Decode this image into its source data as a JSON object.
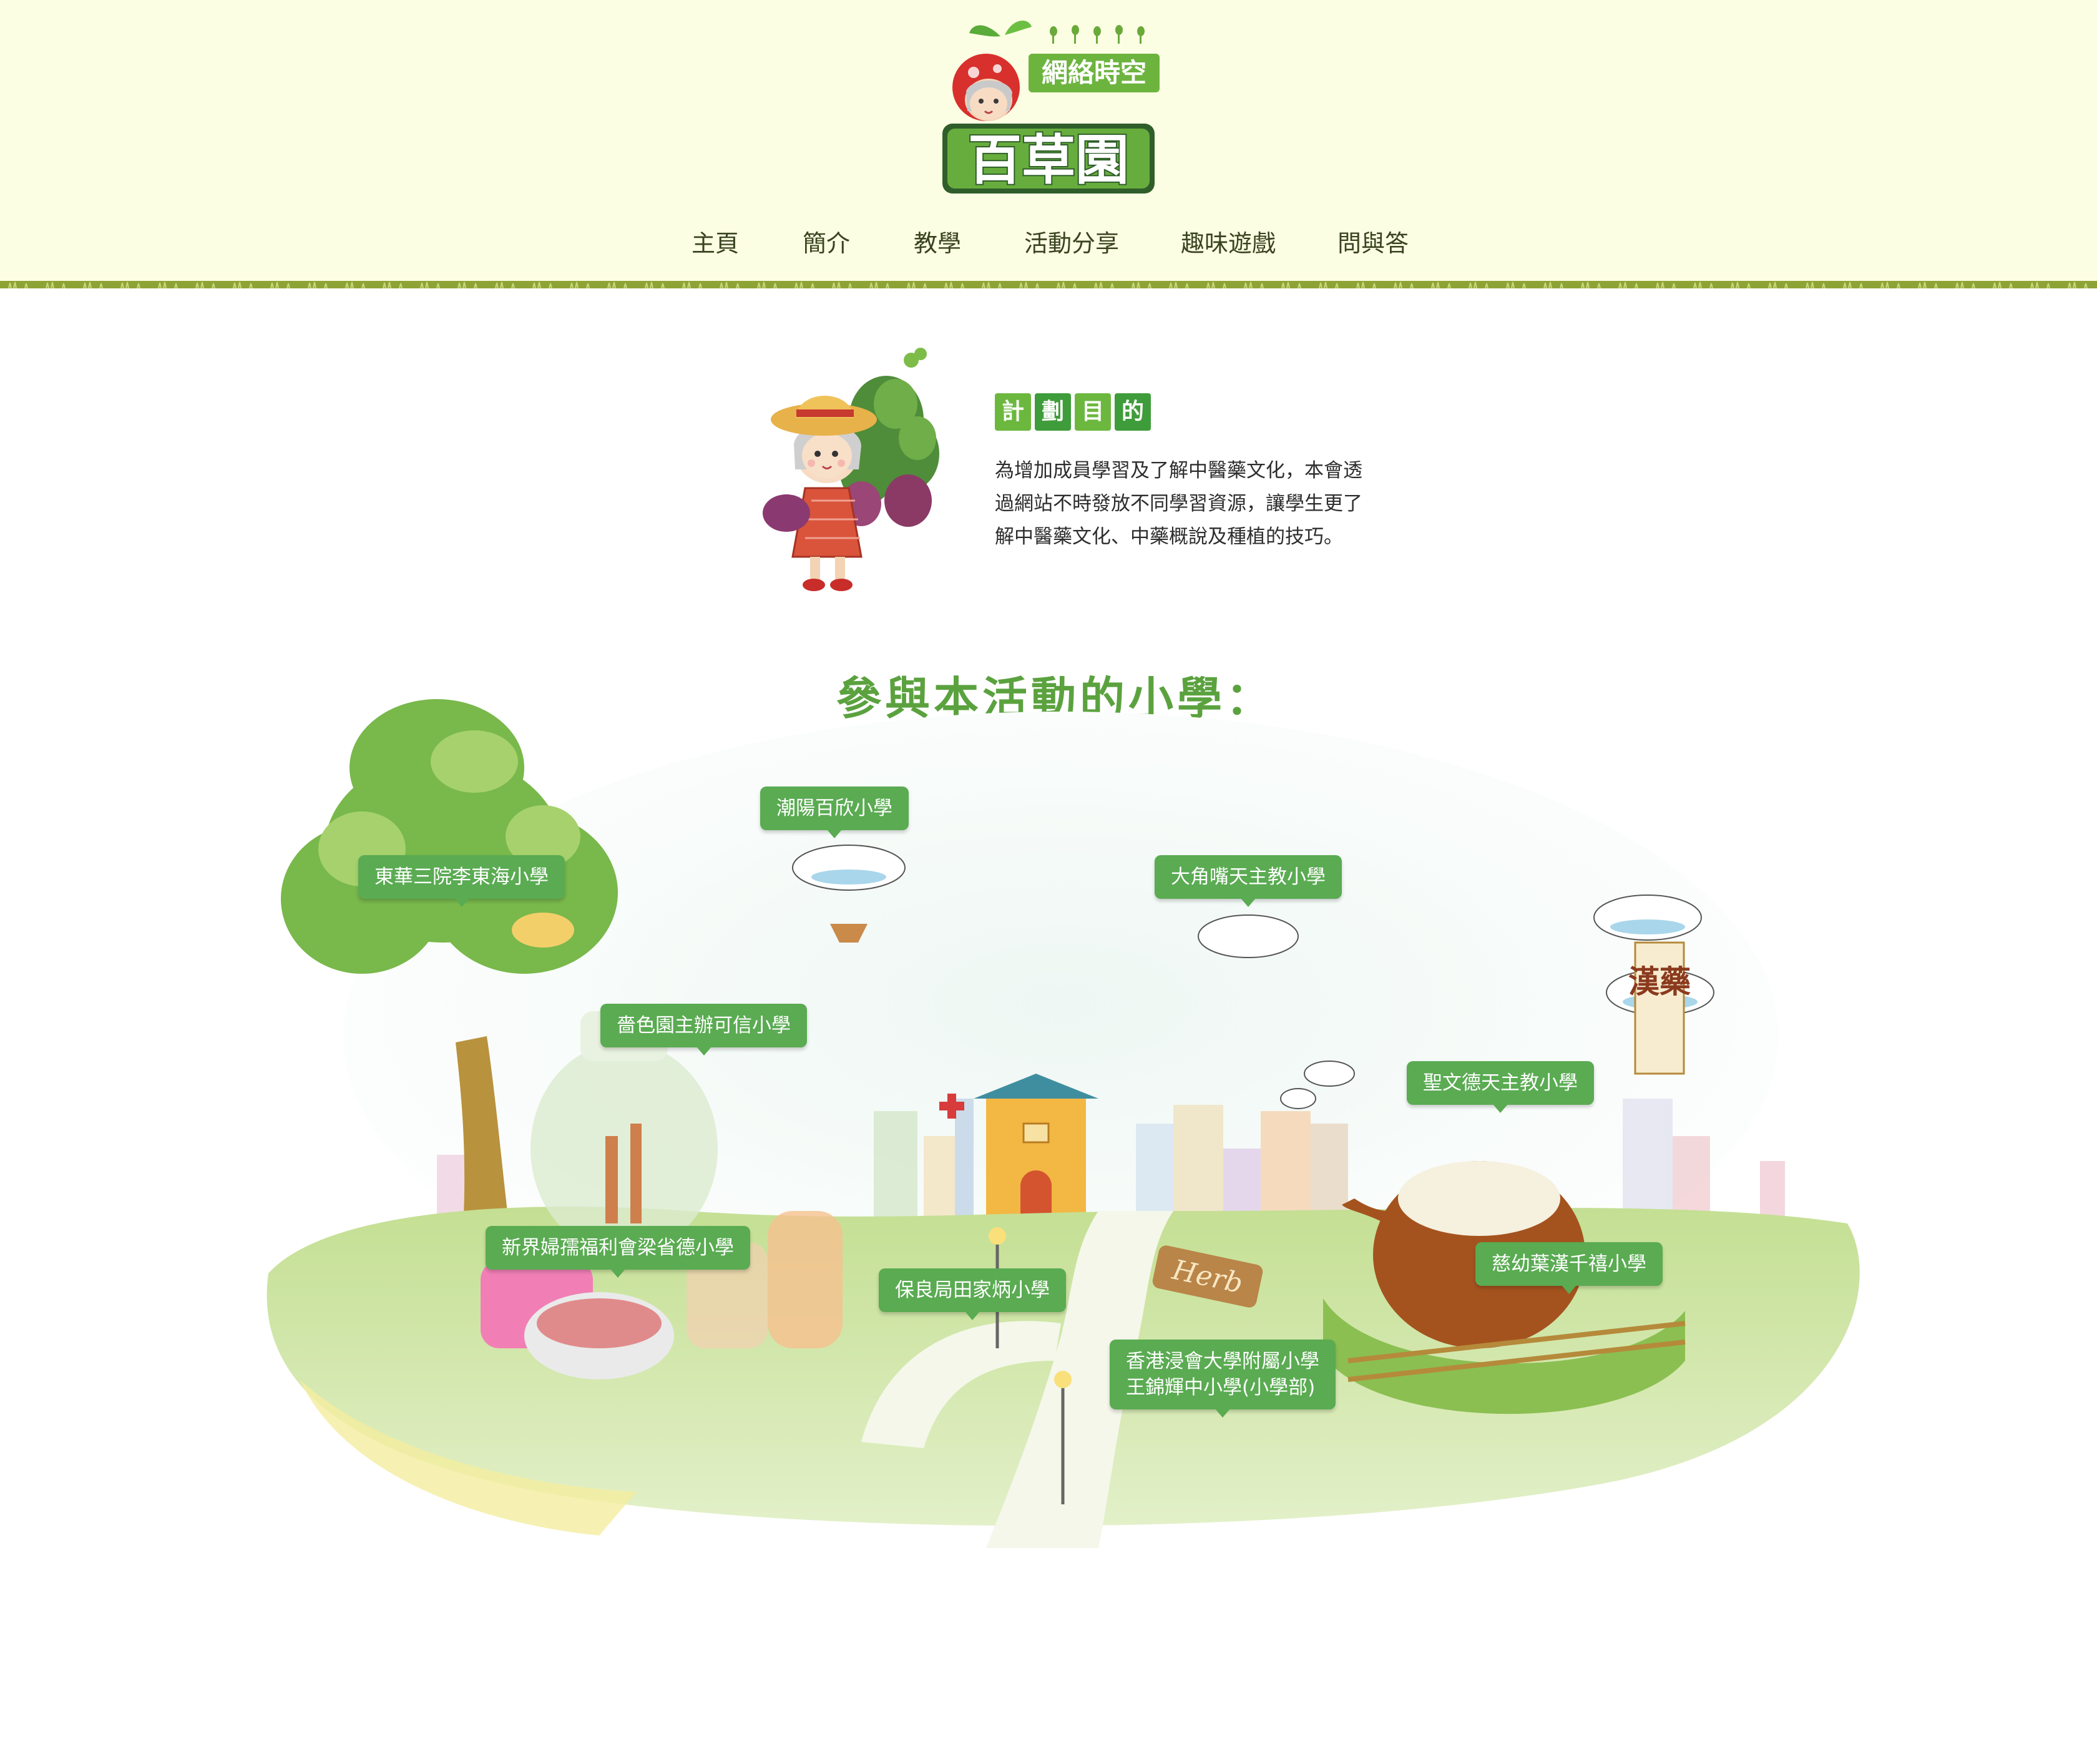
{
  "logo": {
    "top_text": "網絡時空",
    "main_text": "百草園"
  },
  "nav": {
    "items": [
      "主頁",
      "簡介",
      "教學",
      "活動分享",
      "趣味遊戲",
      "問與答"
    ]
  },
  "goal": {
    "title_chars": [
      "計",
      "劃",
      "目",
      "的"
    ],
    "title_colors": [
      "#6cb83f",
      "#3f9c3a",
      "#6cb83f",
      "#3f9c3a"
    ],
    "body_lines": [
      "為增加成員學習及了解中醫藥文化，本會透",
      "過網站不時發放不同學習資源，讓學生更了",
      "解中醫藥文化、中藥概說及種植的技巧。"
    ]
  },
  "schools": {
    "heading": "參與本活動的小學：",
    "banner_text": "漢藥",
    "sign_text": "Herb",
    "tags": [
      "潮陽百欣小學",
      "東華三院李東海小學",
      "大角嘴天主教小學",
      "嗇色園主辦可信小學",
      "聖文德天主教小學",
      "新界婦孺福利會梁省德小學",
      "慈幼葉漢千禧小學",
      "保良局田家炳小學",
      "香港浸會大學附屬小學\n王錦輝中小學(小學部)"
    ]
  },
  "colors": {
    "header_bg": "#fcfee3",
    "nav_text": "#3a4320",
    "accent_green": "#5aab52",
    "heading_green": "#5ba23f",
    "border_olive": "#8ea335"
  }
}
